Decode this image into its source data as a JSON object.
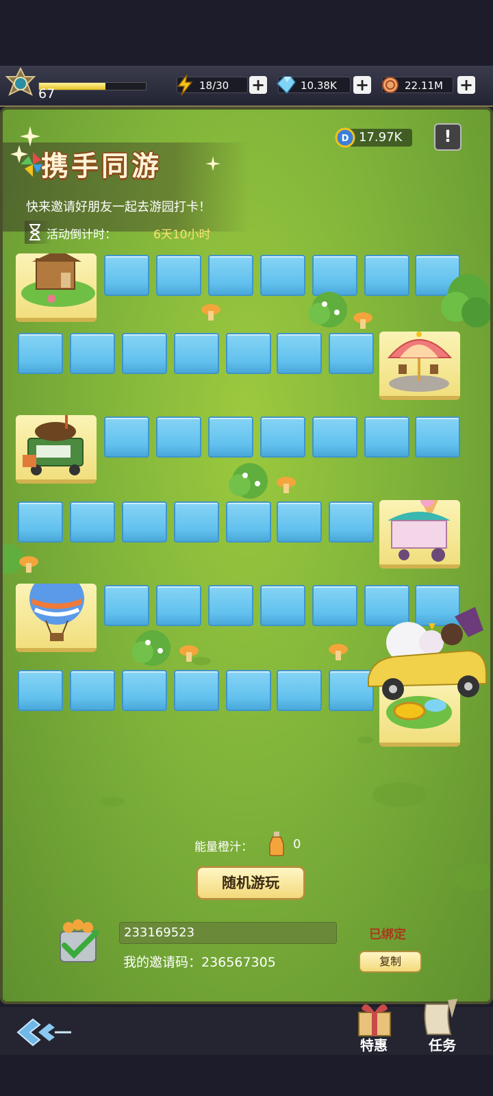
{
  "status": {
    "level": "67",
    "exp_fraction": 0.62,
    "energy": "18/30",
    "diamonds": "10.38K",
    "coins": "22.11M"
  },
  "event": {
    "title": "携手同游",
    "subtitle": "快来邀请好朋友一起去游园打卡！",
    "countdown_label": "活动倒计时：",
    "countdown_value": "6天10小时",
    "ticket_count": "17.97K",
    "info_icon": "exclamation-icon"
  },
  "board": {
    "landmarks": [
      "treehouse",
      "carousel",
      "coffee-truck",
      "ice-cream-cart",
      "hot-air-balloon",
      "fountain"
    ]
  },
  "controls": {
    "juice_label": "能量橙汁：",
    "juice_count": "0",
    "play_label": "随机游玩",
    "invite_value": "233169523",
    "bound_label": "已绑定",
    "my_code_label": "我的邀请码：236567305",
    "copy_label": "复制"
  },
  "footer": {
    "deals_label": "特惠",
    "tasks_label": "任务"
  },
  "colors": {
    "tile": "#62c1ee",
    "node": "#f7e89a",
    "grass": "#7fb33a",
    "accent": "#ffe173"
  }
}
